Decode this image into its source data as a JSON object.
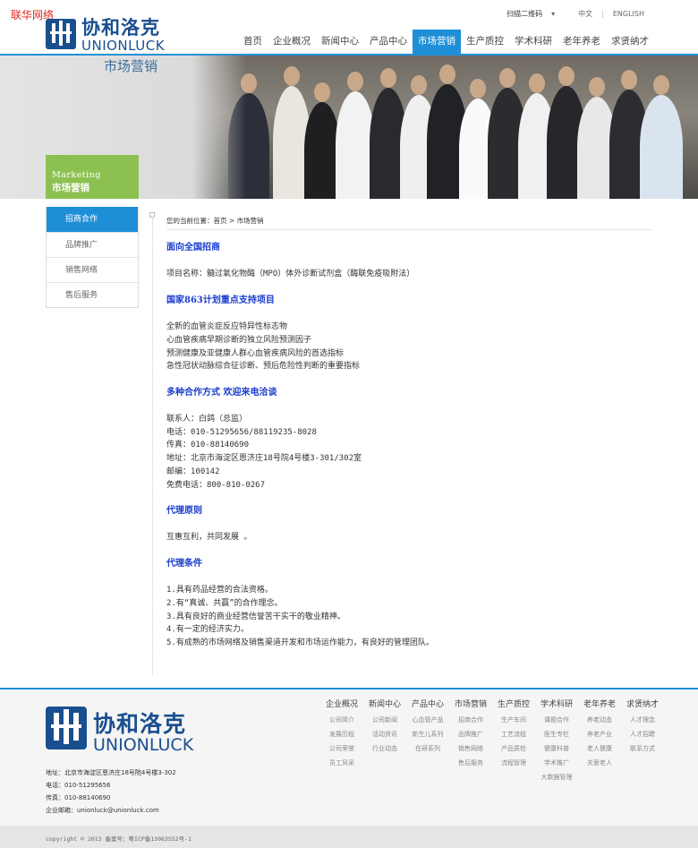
{
  "watermark": "联华网络",
  "brand": {
    "cn": "协和洛克",
    "en": "UNIONLUCK"
  },
  "topbar": {
    "qr": "扫描二维码",
    "lang_cn": "中文",
    "lang_en": "ENGLISH"
  },
  "nav": [
    "首页",
    "企业概况",
    "新闻中心",
    "产品中心",
    "市场营销",
    "生产质控",
    "学术科研",
    "老年养老",
    "求贤纳才"
  ],
  "nav_active": 4,
  "banner": {
    "title": "市场营销",
    "box_en": "Marketing",
    "box_cn": "市场营销"
  },
  "side_menu": [
    "招商合作",
    "品牌推广",
    "销售网络",
    "售后服务"
  ],
  "side_active": 0,
  "breadcrumb": "您的当前位置：首页 > 市场营销",
  "content": [
    {
      "type": "h",
      "text": "面向全国招商"
    },
    {
      "type": "gap"
    },
    {
      "type": "p",
      "text": "项目名称：髓过氧化物酶（MPO）体外诊断试剂盒（酶联免疫吸附法）"
    },
    {
      "type": "gap"
    },
    {
      "type": "h",
      "text": "国家863计划重点支持项目"
    },
    {
      "type": "gap"
    },
    {
      "type": "p",
      "text": "全新的血管炎症反应特异性标志物"
    },
    {
      "type": "p",
      "text": "心血管疾病早期诊断的独立风险预测因子"
    },
    {
      "type": "p",
      "text": "预测健康及亚健康人群心血管疾病风险的首选指标"
    },
    {
      "type": "p",
      "text": "急性冠状动脉综合征诊断、预后危险性判断的重要指标"
    },
    {
      "type": "gap"
    },
    {
      "type": "h",
      "text": "多种合作方式 欢迎来电洽谈"
    },
    {
      "type": "gap"
    },
    {
      "type": "p",
      "text": "联系人：白鸽（总监）"
    },
    {
      "type": "p",
      "text": "电话：010-51295656/88119235-8028"
    },
    {
      "type": "p",
      "text": "传真：010-88140690"
    },
    {
      "type": "p",
      "text": "地址：北京市海淀区恩济庄18号院4号楼3-301/302室"
    },
    {
      "type": "p",
      "text": "邮编：100142"
    },
    {
      "type": "p",
      "text": "免费电话：800-810-0267"
    },
    {
      "type": "gap"
    },
    {
      "type": "h",
      "text": "代理原则"
    },
    {
      "type": "gap"
    },
    {
      "type": "p",
      "text": "互惠互利，共同发展 。"
    },
    {
      "type": "gap"
    },
    {
      "type": "h",
      "text": "代理条件"
    },
    {
      "type": "gap"
    },
    {
      "type": "p",
      "text": "1.具有药品经营的合法资格。"
    },
    {
      "type": "p",
      "text": "2.有“真诚、共赢”的合作理念。"
    },
    {
      "type": "p",
      "text": "3.具有良好的商业经营信誉苦干实干的敬业精神。"
    },
    {
      "type": "p",
      "text": "4.有一定的经济实力。"
    },
    {
      "type": "p",
      "text": "5.有成熟的市场网络及销售渠道开发和市场运作能力，有良好的管理团队。"
    }
  ],
  "footer": {
    "info": [
      "地址：北京市海淀区恩济庄18号院4号楼3-302",
      "电话：010-51295656",
      "传真：010-88140690",
      "企业邮箱：unionluck@unionluck.com"
    ],
    "columns": [
      {
        "title": "企业概况",
        "links": [
          "公司简介",
          "发展历程",
          "公司荣誉",
          "员工风采"
        ]
      },
      {
        "title": "新闻中心",
        "links": [
          "公司新闻",
          "活动资讯",
          "行业动态"
        ]
      },
      {
        "title": "产品中心",
        "links": [
          "心血管产品",
          "新生儿系列",
          "在研系列"
        ]
      },
      {
        "title": "市场营销",
        "links": [
          "招商合作",
          "品牌推广",
          "销售网络",
          "售后服务"
        ]
      },
      {
        "title": "生产质控",
        "links": [
          "生产车间",
          "工艺流程",
          "产品质检",
          "流程管理"
        ]
      },
      {
        "title": "学术科研",
        "links": [
          "课题合作",
          "医生专栏",
          "健康科普",
          "学术推广",
          "大数据管理"
        ]
      },
      {
        "title": "老年养老",
        "links": [
          "养老动态",
          "养老产业",
          "老人健康",
          "关爱老人"
        ]
      },
      {
        "title": "求贤纳才",
        "links": [
          "人才理念",
          "人才招聘",
          "联系方式"
        ]
      }
    ],
    "copyright": "copyright © 2013 备案号：粤ICP备13063552号-1"
  },
  "colors": {
    "accent": "#1e8fd6",
    "brand": "#1a4f8f",
    "green": "#8cc152",
    "heading": "#1a3ccf"
  }
}
